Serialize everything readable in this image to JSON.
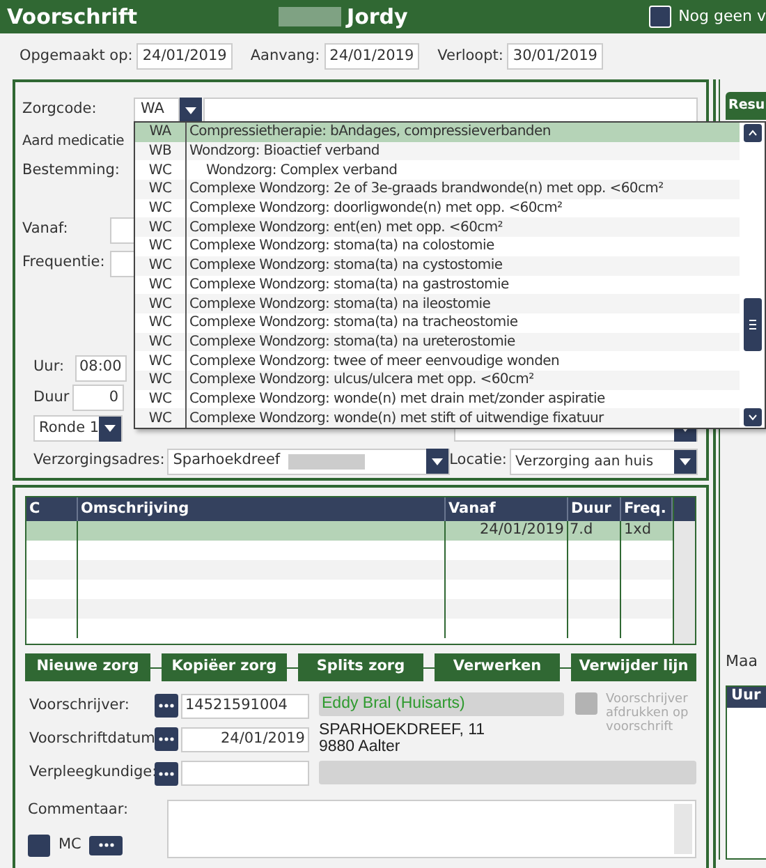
{
  "header": {
    "title": "Voorschrift",
    "patient_name": "Jordy",
    "checkbox": {
      "label": "Nog geen v",
      "checked": false
    }
  },
  "dates": [
    {
      "label": "Opgemaakt op:",
      "value": "24/01/2019"
    },
    {
      "label": "Aanvang:",
      "value": "24/01/2019"
    },
    {
      "label": "Verloopt:",
      "value": "30/01/2019"
    }
  ],
  "zorgcode": {
    "label": "Zorgcode:",
    "value": "WA"
  },
  "dropdown": {
    "items": [
      {
        "code": "WA",
        "text": "Compressietherapie: bAndages, compressieverbanden",
        "kind": "entry",
        "selected": true
      },
      {
        "code": "WB",
        "text": "Wondzorg: Bioactief verband",
        "kind": "entry",
        "selected": false
      },
      {
        "code": "WC",
        "text": "Wondzorg: Complex verband",
        "kind": "sub",
        "selected": false
      },
      {
        "code": "WC",
        "text": "Complexe Wondzorg: 2e of 3e-graads brandwonde(n) met opp. <60cm²",
        "kind": "entry",
        "selected": false
      },
      {
        "code": "WC",
        "text": "Complexe Wondzorg: doorligwonde(n) met opp. <60cm²",
        "kind": "entry",
        "selected": false
      },
      {
        "code": "WC",
        "text": "Complexe Wondzorg: ent(en) met opp. <60cm²",
        "kind": "entry",
        "selected": false
      },
      {
        "code": "WC",
        "text": "Complexe Wondzorg: stoma(ta) na colostomie",
        "kind": "entry",
        "selected": false
      },
      {
        "code": "WC",
        "text": "Complexe Wondzorg: stoma(ta) na cystostomie",
        "kind": "entry",
        "selected": false
      },
      {
        "code": "WC",
        "text": "Complexe Wondzorg: stoma(ta) na gastrostomie",
        "kind": "entry",
        "selected": false
      },
      {
        "code": "WC",
        "text": "Complexe Wondzorg: stoma(ta) na ileostomie",
        "kind": "entry",
        "selected": false
      },
      {
        "code": "WC",
        "text": "Complexe Wondzorg: stoma(ta) na tracheostomie",
        "kind": "entry",
        "selected": false
      },
      {
        "code": "WC",
        "text": "Complexe Wondzorg: stoma(ta) na ureterostomie",
        "kind": "entry",
        "selected": false
      },
      {
        "code": "WC",
        "text": "Complexe Wondzorg: twee of meer eenvoudige wonden",
        "kind": "entry",
        "selected": false
      },
      {
        "code": "WC",
        "text": "Complexe Wondzorg: ulcus/ulcera met opp. <60cm²",
        "kind": "entry",
        "selected": false
      },
      {
        "code": "WC",
        "text": "Complexe Wondzorg: wonde(n) met drain met/zonder aspiratie",
        "kind": "entry",
        "selected": false
      },
      {
        "code": "WC",
        "text": "Complexe Wondzorg: wonde(n) met stift of uitwendige fixatuur",
        "kind": "entry",
        "selected": false
      }
    ]
  },
  "form": {
    "aard_medicatie": "Aard medicatie",
    "bestemming": "Bestemming:",
    "vanaf": "Vanaf:",
    "frequentie": "Frequentie:",
    "uur": {
      "label": "Uur:",
      "value": "08:00"
    },
    "duur": {
      "label": "Duur",
      "value": "0"
    },
    "ronde": "Ronde 1",
    "verzorgingsadres": {
      "label": "Verzorgingsadres:",
      "value": "Sparhoekdreef"
    },
    "locatie": {
      "label": "Locatie:",
      "value": "Verzorging aan huis"
    }
  },
  "table": {
    "columns": [
      "C",
      "Omschrijving",
      "Vanaf",
      "Duur",
      "Freq."
    ],
    "rows": [
      {
        "vanaf": "24/01/2019",
        "duur": "7.d",
        "freq": "1xd",
        "selected": true
      }
    ]
  },
  "buttons": [
    "Nieuwe zorg",
    "Kopiëer zorg",
    "Splits zorg",
    "Verwerken",
    "Verwijder lijn"
  ],
  "prescriber": {
    "voorschrijver_label": "Voorschrijver:",
    "voorschrijver_value": "14521591004",
    "name": "Eddy Bral (Huisarts)",
    "datum_label": "Voorschriftdatum",
    "datum_value": "24/01/2019",
    "address": [
      "SPARHOEKDREEF, 11",
      "9880 Aalter"
    ],
    "print_label": "Voorschrijver afdrukken op voorschrift",
    "print_checked": false,
    "verpleeg_label": "Verpleegkundige:",
    "commentaar_label": "Commentaar:",
    "mc_label": "MC",
    "mc_checked": false
  },
  "right_panel": {
    "button": "Resu",
    "label": "Maa",
    "table_header": "Uur"
  }
}
